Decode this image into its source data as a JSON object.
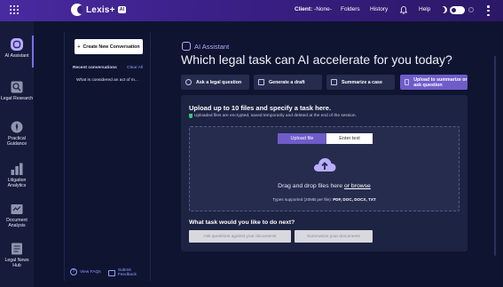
{
  "header": {
    "logo_text": "Lexis+",
    "logo_badge": "AI",
    "client_label": "Client:",
    "client_value": "-None-",
    "folders": "Folders",
    "history": "History",
    "help": "Help"
  },
  "rail": [
    {
      "label": "AI Assistant",
      "icon": "ai-assistant-icon"
    },
    {
      "label": "Legal Research",
      "icon": "legal-research-icon"
    },
    {
      "label": "Practical Guidance",
      "icon": "practical-guidance-icon"
    },
    {
      "label": "Litigation Analytics",
      "icon": "litigation-analytics-icon"
    },
    {
      "label": "Document Analysis",
      "icon": "document-analysis-icon"
    },
    {
      "label": "Legal News Hub",
      "icon": "legal-news-icon"
    }
  ],
  "conversations": {
    "new_button": "Create New Conversation",
    "recent_label": "Recent conversations",
    "clear_all": "Clear All",
    "items": [
      "What is considered an act of m..."
    ],
    "view_faqs": "View FAQs",
    "submit_feedback": "Submit Feedback"
  },
  "main": {
    "assistant_label": "AI Assistant",
    "headline": "Which legal task can AI accelerate for you today?",
    "tasks": [
      {
        "label": "Ask a legal question"
      },
      {
        "label": "Generate a draft"
      },
      {
        "label": "Summarize a case"
      },
      {
        "label": "Upload to summarize or ask question"
      }
    ],
    "upload_title": "Upload up to 10 files and specify a task here.",
    "upload_note": "Uploaded files are encrypted, saved temporarily and deleted at the end of the session.",
    "tab_upload": "Upload file",
    "tab_enter": "Enter text",
    "drop_text": "Drag and drop files here",
    "drop_link": "or browse",
    "types_label": "Types supported (20MB per file):",
    "types_value": "PDF, DOC, DOCX, TXT",
    "next_title": "What task would you like to do next?",
    "next_buttons": [
      "Ask questions against your documents",
      "Summarize your documents"
    ]
  }
}
